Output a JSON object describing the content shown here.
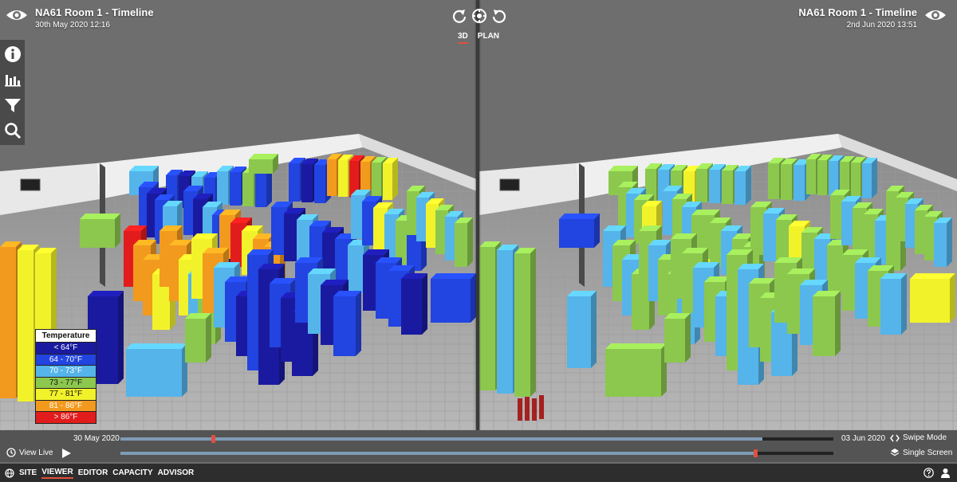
{
  "left_view": {
    "title": "NA61 Room 1 - Timeline",
    "date": "30th May 2020 12:16"
  },
  "right_view": {
    "title": "NA61 Room 1 - Timeline",
    "date": "2nd Jun 2020 13:51"
  },
  "view_modes": {
    "mode_3d": "3D",
    "mode_plan": "PLAN",
    "active": "3D"
  },
  "icons": {
    "eye": "eye-icon",
    "rotate_left": "rotate-left-icon",
    "reset": "reset-view-icon",
    "rotate_right": "rotate-right-icon",
    "info": "info-icon",
    "chart": "bar-chart-icon",
    "filter": "filter-icon",
    "search": "search-icon",
    "view_live": "clock-icon",
    "play": "play-icon",
    "swipe": "swipe-icon",
    "layers": "layers-icon",
    "globe": "globe-icon",
    "help": "help-icon",
    "user": "user-icon"
  },
  "legend": {
    "title": "Temperature",
    "items": [
      {
        "label": "< 64°F",
        "color": "#1a1aa0"
      },
      {
        "label": "64 - 70°F",
        "color": "#2244e0"
      },
      {
        "label": "70 - 73°F",
        "color": "#55b4ea"
      },
      {
        "label": "73 - 77°F",
        "color": "#8cc84e"
      },
      {
        "label": "77 - 81°F",
        "color": "#f2f22a"
      },
      {
        "label": "81 - 86°F",
        "color": "#f29a1e"
      },
      {
        "label": "> 86°F",
        "color": "#e21c1c"
      }
    ]
  },
  "timeline": {
    "start_date": "30 May 2020",
    "end_date": "03 Jun 2020",
    "top_position": 0.13,
    "bottom_position": 0.89,
    "view_live_label": "View Live",
    "swipe_mode_label": "Swipe Mode",
    "single_screen_label": "Single Screen"
  },
  "nav": {
    "items": [
      "SITE",
      "VIEWER",
      "EDITOR",
      "CAPACITY",
      "ADVISOR"
    ],
    "active": "VIEWER"
  }
}
